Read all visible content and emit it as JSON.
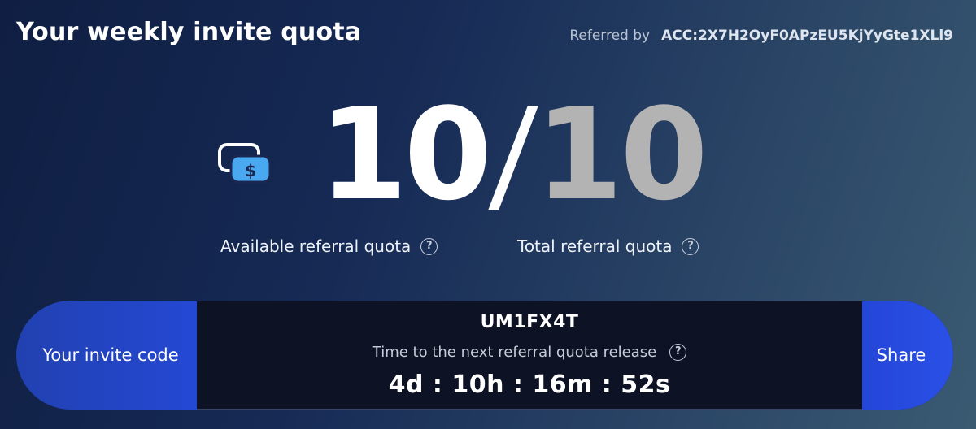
{
  "header": {
    "title": "Your weekly invite quota",
    "referred_label": "Referred by",
    "referred_value": "ACC:2X7H2OyF0APzEU5KjYyGte1XLl9"
  },
  "quota": {
    "icon": "money-cards-icon",
    "available": "10",
    "separator": "/",
    "total": "10",
    "available_label": "Available referral quota",
    "total_label": "Total referral quota"
  },
  "invite": {
    "label": "Your invite code",
    "code": "UM1FX4T",
    "release_label": "Time to the next referral quota release",
    "countdown": "4d : 10h : 16m : 52s",
    "share_label": "Share"
  },
  "colors": {
    "accent_blue": "#2448d4",
    "icon_blue": "#4aa8f0",
    "total_gray": "#b3b3b3"
  }
}
